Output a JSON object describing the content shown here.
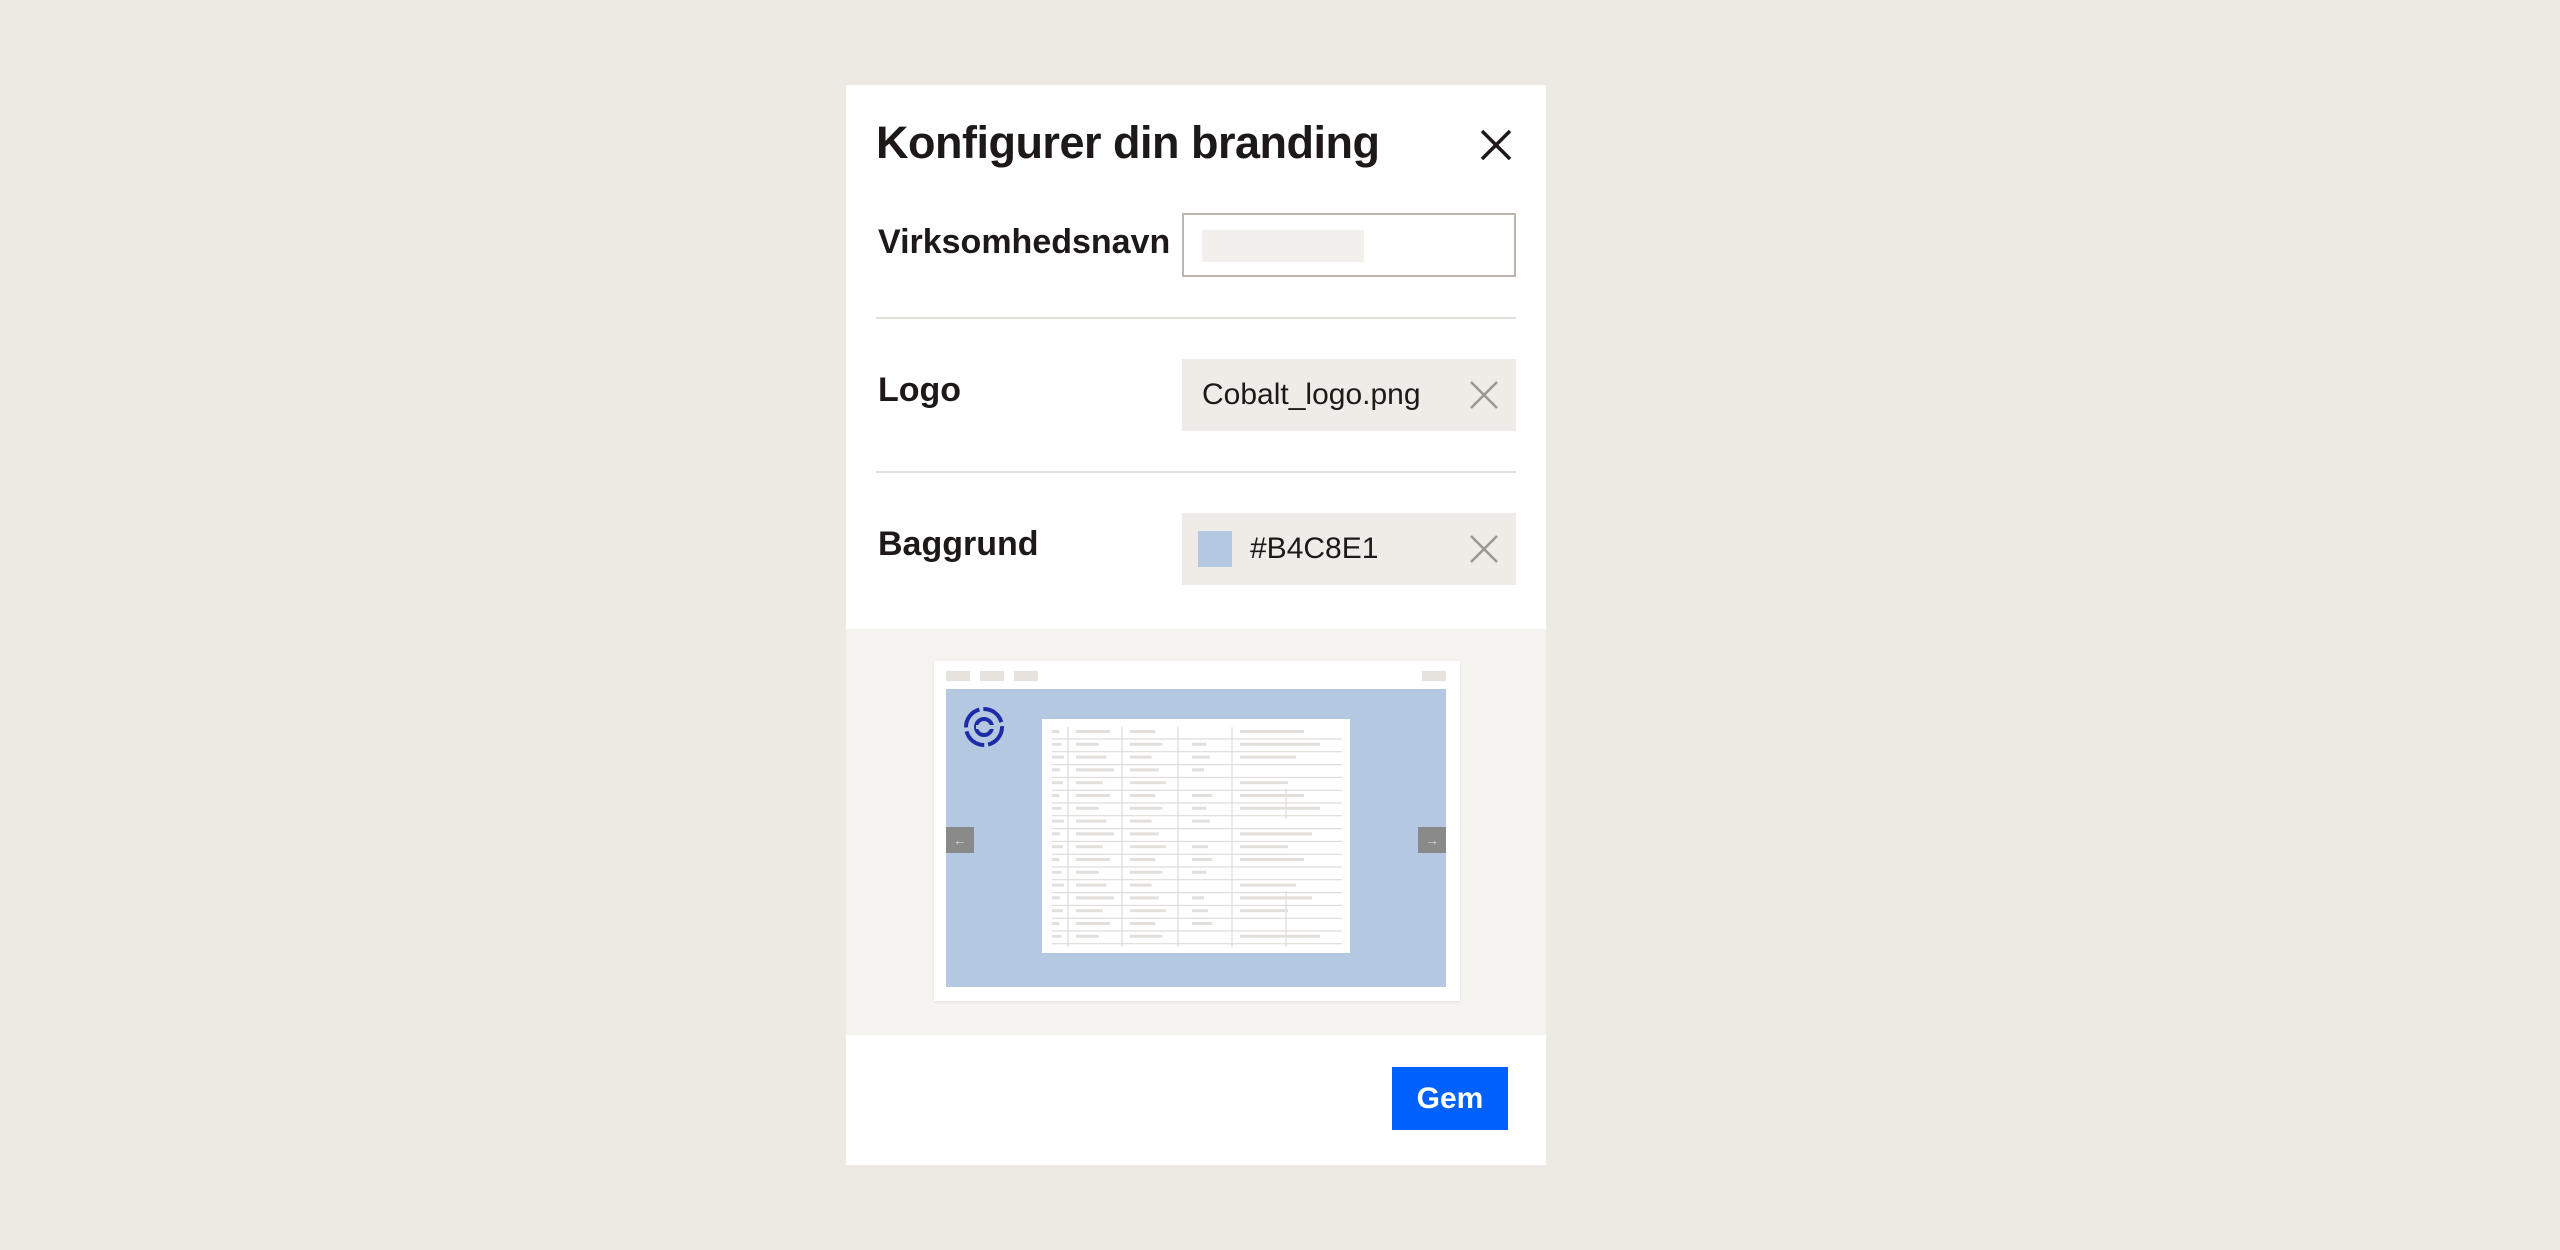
{
  "dialog": {
    "title": "Konfigurer din branding",
    "close_icon": "close-icon"
  },
  "company_name": {
    "label": "Virksomhedsnavn",
    "value": ""
  },
  "logo": {
    "label": "Logo",
    "file_name": "Cobalt_logo.png",
    "clear_icon": "close-icon"
  },
  "background": {
    "label": "Baggrund",
    "color_value": "#B4C8E1",
    "swatch_color": "#B4C8E1",
    "clear_icon": "close-icon"
  },
  "preview": {
    "background_color": "#B4C8E1",
    "logo_color": "#1E2BA8",
    "prev_arrow": "←",
    "next_arrow": "→"
  },
  "footer": {
    "save_label": "Gem",
    "accent_color": "#0061FE"
  }
}
